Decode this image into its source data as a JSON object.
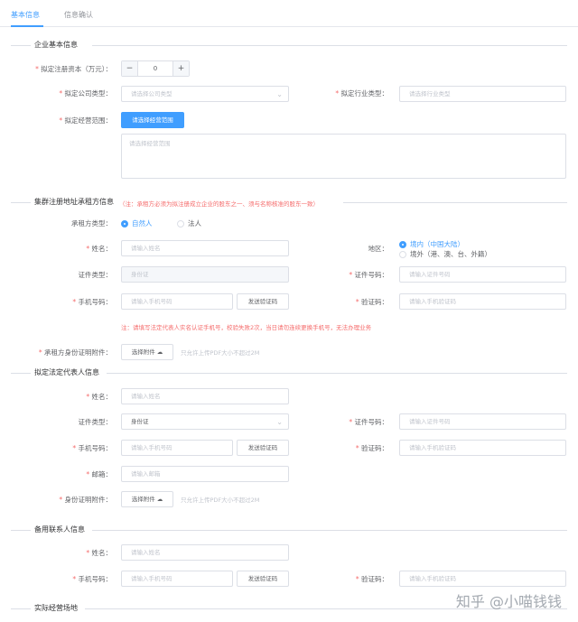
{
  "tabs": [
    "基本信息",
    "信息确认"
  ],
  "sections": {
    "company": "企业基本信息",
    "lessor": "集群注册地址承租方信息",
    "legal": "拟定法定代表人信息",
    "backup": "备用联系人信息",
    "site": "实际经营场地"
  },
  "lessor_note": "（注：承租方必须为拟注册成立企业的股东之一、须与名称核准的股东一致）",
  "company": {
    "capital_label": "拟定注册资本（万元）：",
    "capital_value": "0",
    "minus": "−",
    "plus": "+",
    "type_label": "拟定公司类型：",
    "type_placeholder": "请选择公司类型",
    "industry_label": "拟定行业类型：",
    "industry_placeholder": "请选择行业类型",
    "scope_label": "拟定经营范围：",
    "scope_button": "请选择经营范围",
    "scope_placeholder": "请选择经营范围"
  },
  "lessor": {
    "type_label": "承租方类型：",
    "type_options": [
      "自然人",
      "法人"
    ],
    "name_label": "姓名：",
    "name_placeholder": "请输入姓名",
    "region_label": "地区：",
    "region_options": [
      "境内（中国大陆）",
      "境外（港、澳、台、外籍）"
    ],
    "idtype_label": "证件类型：",
    "idtype_value": "身份证",
    "idno_label": "证件号码：",
    "idno_placeholder": "请输入证件号码",
    "phone_label": "手机号码：",
    "phone_placeholder": "请输入手机号码",
    "sms_button": "发送验证码",
    "code_label": "验证码：",
    "code_placeholder": "请输入手机验证码",
    "phone_note": "注：请填写法定代表人实名认证手机号，校验失败2次，当日请勿连续更换手机号，无法办理业务",
    "attach_label": "承租方身份证明附件：",
    "attach_button": "选择附件",
    "attach_hint": "只允许上传PDF大小不超过2M"
  },
  "legal": {
    "name_label": "姓名：",
    "name_placeholder": "请输入姓名",
    "idtype_label": "证件类型：",
    "idtype_value": "身份证",
    "idno_label": "证件号码：",
    "idno_placeholder": "请输入证件号码",
    "phone_label": "手机号码：",
    "phone_placeholder": "请输入手机号码",
    "sms_button": "发送验证码",
    "code_label": "验证码：",
    "code_placeholder": "请输入手机验证码",
    "email_label": "邮箱：",
    "email_placeholder": "请输入邮箱",
    "attach_label": "身份证明附件：",
    "attach_button": "选择附件",
    "attach_hint": "只允许上传PDF大小不超过2M"
  },
  "backup": {
    "name_label": "姓名：",
    "name_placeholder": "请输入姓名",
    "phone_label": "手机号码：",
    "phone_placeholder": "请输入手机号码",
    "sms_button": "发送验证码",
    "code_label": "验证码：",
    "code_placeholder": "请输入手机验证码"
  },
  "watermark": "知乎 @小喵钱钱",
  "colors": {
    "primary": "#409eff",
    "danger": "#f56c6c",
    "border": "#dcdfe6"
  }
}
